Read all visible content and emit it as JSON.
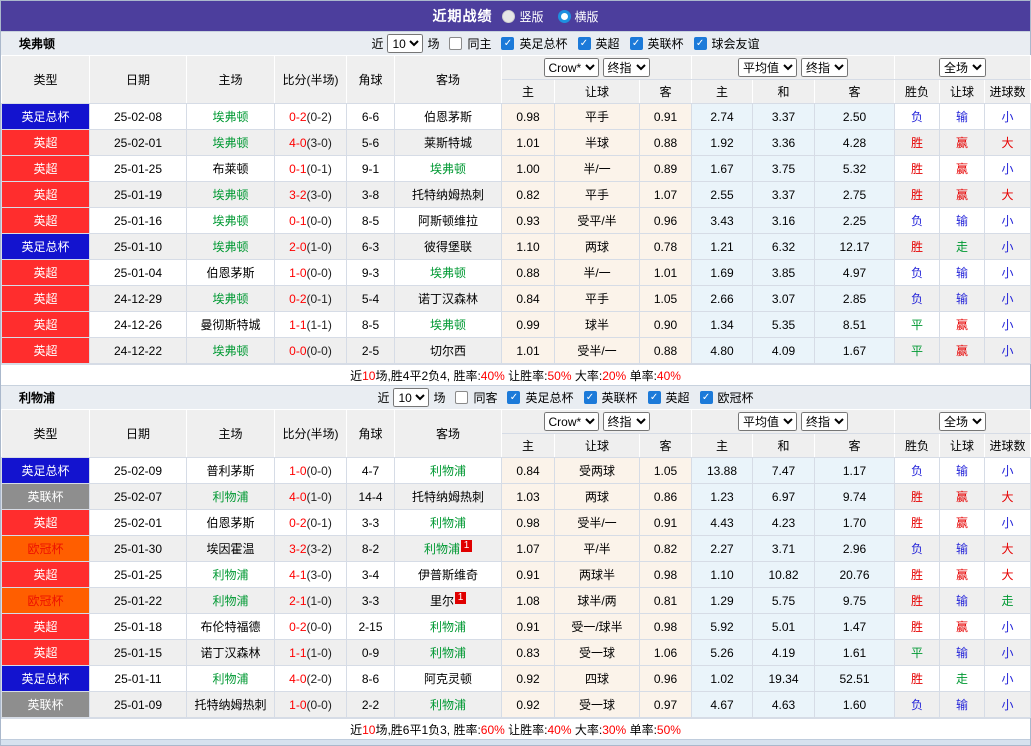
{
  "title_bar": {
    "title": "近期战绩",
    "layout_options": [
      {
        "label": "竖版",
        "selected": true
      },
      {
        "label": "横版",
        "selected": false
      }
    ]
  },
  "columns": {
    "main": [
      "类型",
      "日期",
      "主场",
      "比分(半场)",
      "角球",
      "客场"
    ],
    "odds_groups": [
      {
        "selects": [
          "Crow*",
          "终指"
        ],
        "cols": [
          "主",
          "让球",
          "客"
        ]
      },
      {
        "selects": [
          "平均值",
          "终指"
        ],
        "cols": [
          "主",
          "和",
          "客"
        ]
      },
      {
        "selects": [
          "全场"
        ],
        "cols": [
          "胜负",
          "让球",
          "进球数"
        ]
      }
    ]
  },
  "league_colors": {
    "英足总杯": {
      "bg": "#1313cf",
      "text": "#ffffff"
    },
    "英超": {
      "bg": "#ff2d2d",
      "text": "#ffffff"
    },
    "英联杯": {
      "bg": "#8e8e8e",
      "text": "#ffffff"
    },
    "欧冠杯": {
      "bg": "#ff5e00",
      "text": "#ee1100"
    }
  },
  "result_colors": {
    "胜": "#e60000",
    "赢": "#e60000",
    "大": "#e60000",
    "负": "#2626d9",
    "输": "#2626d9",
    "小": "#2626d9",
    "平": "#009933",
    "走": "#009933"
  },
  "sections": [
    {
      "team": "埃弗顿",
      "filter": {
        "prefix": "近",
        "count": "10",
        "suffix": "场",
        "same_label": "同主",
        "same_checked": false,
        "leagues": [
          {
            "label": "英足总杯",
            "checked": true
          },
          {
            "label": "英超",
            "checked": true
          },
          {
            "label": "英联杯",
            "checked": true
          },
          {
            "label": "球会友谊",
            "checked": true
          }
        ]
      },
      "rows": [
        {
          "league": "英足总杯",
          "date": "25-02-08",
          "home": "埃弗顿",
          "home_self": true,
          "ft": "0-2",
          "ht": "(0-2)",
          "corner": "6-6",
          "away": "伯恩茅斯",
          "away_self": false,
          "away_flag": "",
          "crow": [
            "0.98",
            "平手",
            "0.91"
          ],
          "avg": [
            "2.74",
            "3.37",
            "2.50"
          ],
          "results": [
            "负",
            "输",
            "小"
          ]
        },
        {
          "league": "英超",
          "date": "25-02-01",
          "home": "埃弗顿",
          "home_self": true,
          "ft": "4-0",
          "ht": "(3-0)",
          "corner": "5-6",
          "away": "莱斯特城",
          "away_self": false,
          "away_flag": "",
          "crow": [
            "1.01",
            "半球",
            "0.88"
          ],
          "avg": [
            "1.92",
            "3.36",
            "4.28"
          ],
          "results": [
            "胜",
            "赢",
            "大"
          ]
        },
        {
          "league": "英超",
          "date": "25-01-25",
          "home": "布莱顿",
          "home_self": false,
          "ft": "0-1",
          "ht": "(0-1)",
          "corner": "9-1",
          "away": "埃弗顿",
          "away_self": true,
          "away_flag": "",
          "crow": [
            "1.00",
            "半/一",
            "0.89"
          ],
          "avg": [
            "1.67",
            "3.75",
            "5.32"
          ],
          "results": [
            "胜",
            "赢",
            "小"
          ]
        },
        {
          "league": "英超",
          "date": "25-01-19",
          "home": "埃弗顿",
          "home_self": true,
          "ft": "3-2",
          "ht": "(3-0)",
          "corner": "3-8",
          "away": "托特纳姆热刺",
          "away_self": false,
          "away_flag": "",
          "crow": [
            "0.82",
            "平手",
            "1.07"
          ],
          "avg": [
            "2.55",
            "3.37",
            "2.75"
          ],
          "results": [
            "胜",
            "赢",
            "大"
          ]
        },
        {
          "league": "英超",
          "date": "25-01-16",
          "home": "埃弗顿",
          "home_self": true,
          "ft": "0-1",
          "ht": "(0-0)",
          "corner": "8-5",
          "away": "阿斯顿维拉",
          "away_self": false,
          "away_flag": "",
          "crow": [
            "0.93",
            "受平/半",
            "0.96"
          ],
          "avg": [
            "3.43",
            "3.16",
            "2.25"
          ],
          "results": [
            "负",
            "输",
            "小"
          ]
        },
        {
          "league": "英足总杯",
          "date": "25-01-10",
          "home": "埃弗顿",
          "home_self": true,
          "ft": "2-0",
          "ht": "(1-0)",
          "corner": "6-3",
          "away": "彼得堡联",
          "away_self": false,
          "away_flag": "",
          "crow": [
            "1.10",
            "两球",
            "0.78"
          ],
          "avg": [
            "1.21",
            "6.32",
            "12.17"
          ],
          "results": [
            "胜",
            "走",
            "小"
          ]
        },
        {
          "league": "英超",
          "date": "25-01-04",
          "home": "伯恩茅斯",
          "home_self": false,
          "ft": "1-0",
          "ht": "(0-0)",
          "corner": "9-3",
          "away": "埃弗顿",
          "away_self": true,
          "away_flag": "",
          "crow": [
            "0.88",
            "半/一",
            "1.01"
          ],
          "avg": [
            "1.69",
            "3.85",
            "4.97"
          ],
          "results": [
            "负",
            "输",
            "小"
          ]
        },
        {
          "league": "英超",
          "date": "24-12-29",
          "home": "埃弗顿",
          "home_self": true,
          "ft": "0-2",
          "ht": "(0-1)",
          "corner": "5-4",
          "away": "诺丁汉森林",
          "away_self": false,
          "away_flag": "",
          "crow": [
            "0.84",
            "平手",
            "1.05"
          ],
          "avg": [
            "2.66",
            "3.07",
            "2.85"
          ],
          "results": [
            "负",
            "输",
            "小"
          ]
        },
        {
          "league": "英超",
          "date": "24-12-26",
          "home": "曼彻斯特城",
          "home_self": false,
          "ft": "1-1",
          "ht": "(1-1)",
          "corner": "8-5",
          "away": "埃弗顿",
          "away_self": true,
          "away_flag": "",
          "crow": [
            "0.99",
            "球半",
            "0.90"
          ],
          "avg": [
            "1.34",
            "5.35",
            "8.51"
          ],
          "results": [
            "平",
            "赢",
            "小"
          ]
        },
        {
          "league": "英超",
          "date": "24-12-22",
          "home": "埃弗顿",
          "home_self": true,
          "ft": "0-0",
          "ht": "(0-0)",
          "corner": "2-5",
          "away": "切尔西",
          "away_self": false,
          "away_flag": "",
          "crow": [
            "1.01",
            "受半/一",
            "0.88"
          ],
          "avg": [
            "4.80",
            "4.09",
            "1.67"
          ],
          "results": [
            "平",
            "赢",
            "小"
          ]
        }
      ],
      "summary": {
        "segments": [
          {
            "t": "近",
            "c": "k"
          },
          {
            "t": "10",
            "c": "r"
          },
          {
            "t": "场,胜4平2负4, 胜率:",
            "c": "k"
          },
          {
            "t": "40%",
            "c": "r"
          },
          {
            "t": " 让胜率:",
            "c": "k"
          },
          {
            "t": "50%",
            "c": "r"
          },
          {
            "t": " 大率:",
            "c": "k"
          },
          {
            "t": "20%",
            "c": "r"
          },
          {
            "t": " 单率:",
            "c": "k"
          },
          {
            "t": "40%",
            "c": "r"
          }
        ]
      }
    },
    {
      "team": "利物浦",
      "filter": {
        "prefix": "近",
        "count": "10",
        "suffix": "场",
        "same_label": "同客",
        "same_checked": false,
        "leagues": [
          {
            "label": "英足总杯",
            "checked": true
          },
          {
            "label": "英联杯",
            "checked": true
          },
          {
            "label": "英超",
            "checked": true
          },
          {
            "label": "欧冠杯",
            "checked": true
          }
        ]
      },
      "rows": [
        {
          "league": "英足总杯",
          "date": "25-02-09",
          "home": "普利茅斯",
          "home_self": false,
          "ft": "1-0",
          "ht": "(0-0)",
          "corner": "4-7",
          "away": "利物浦",
          "away_self": true,
          "away_flag": "",
          "crow": [
            "0.84",
            "受两球",
            "1.05"
          ],
          "avg": [
            "13.88",
            "7.47",
            "1.17"
          ],
          "results": [
            "负",
            "输",
            "小"
          ]
        },
        {
          "league": "英联杯",
          "date": "25-02-07",
          "home": "利物浦",
          "home_self": true,
          "ft": "4-0",
          "ht": "(1-0)",
          "corner": "14-4",
          "away": "托特纳姆热刺",
          "away_self": false,
          "away_flag": "",
          "crow": [
            "1.03",
            "两球",
            "0.86"
          ],
          "avg": [
            "1.23",
            "6.97",
            "9.74"
          ],
          "results": [
            "胜",
            "赢",
            "大"
          ]
        },
        {
          "league": "英超",
          "date": "25-02-01",
          "home": "伯恩茅斯",
          "home_self": false,
          "ft": "0-2",
          "ht": "(0-1)",
          "corner": "3-3",
          "away": "利物浦",
          "away_self": true,
          "away_flag": "",
          "crow": [
            "0.98",
            "受半/一",
            "0.91"
          ],
          "avg": [
            "4.43",
            "4.23",
            "1.70"
          ],
          "results": [
            "胜",
            "赢",
            "小"
          ]
        },
        {
          "league": "欧冠杯",
          "date": "25-01-30",
          "home": "埃因霍温",
          "home_self": false,
          "ft": "3-2",
          "ht": "(3-2)",
          "corner": "8-2",
          "away": "利物浦",
          "away_self": true,
          "away_flag": "1",
          "crow": [
            "1.07",
            "平/半",
            "0.82"
          ],
          "avg": [
            "2.27",
            "3.71",
            "2.96"
          ],
          "results": [
            "负",
            "输",
            "大"
          ]
        },
        {
          "league": "英超",
          "date": "25-01-25",
          "home": "利物浦",
          "home_self": true,
          "ft": "4-1",
          "ht": "(3-0)",
          "corner": "3-4",
          "away": "伊普斯维奇",
          "away_self": false,
          "away_flag": "",
          "crow": [
            "0.91",
            "两球半",
            "0.98"
          ],
          "avg": [
            "1.10",
            "10.82",
            "20.76"
          ],
          "results": [
            "胜",
            "赢",
            "大"
          ]
        },
        {
          "league": "欧冠杯",
          "date": "25-01-22",
          "home": "利物浦",
          "home_self": true,
          "ft": "2-1",
          "ht": "(1-0)",
          "corner": "3-3",
          "away": "里尔",
          "away_self": false,
          "away_flag": "1",
          "crow": [
            "1.08",
            "球半/两",
            "0.81"
          ],
          "avg": [
            "1.29",
            "5.75",
            "9.75"
          ],
          "results": [
            "胜",
            "输",
            "走"
          ]
        },
        {
          "league": "英超",
          "date": "25-01-18",
          "home": "布伦特福德",
          "home_self": false,
          "ft": "0-2",
          "ht": "(0-0)",
          "corner": "2-15",
          "away": "利物浦",
          "away_self": true,
          "away_flag": "",
          "crow": [
            "0.91",
            "受一/球半",
            "0.98"
          ],
          "avg": [
            "5.92",
            "5.01",
            "1.47"
          ],
          "results": [
            "胜",
            "赢",
            "小"
          ]
        },
        {
          "league": "英超",
          "date": "25-01-15",
          "home": "诺丁汉森林",
          "home_self": false,
          "ft": "1-1",
          "ht": "(1-0)",
          "corner": "0-9",
          "away": "利物浦",
          "away_self": true,
          "away_flag": "",
          "crow": [
            "0.83",
            "受一球",
            "1.06"
          ],
          "avg": [
            "5.26",
            "4.19",
            "1.61"
          ],
          "results": [
            "平",
            "输",
            "小"
          ]
        },
        {
          "league": "英足总杯",
          "date": "25-01-11",
          "home": "利物浦",
          "home_self": true,
          "ft": "4-0",
          "ht": "(2-0)",
          "corner": "8-6",
          "away": "阿克灵顿",
          "away_self": false,
          "away_flag": "",
          "crow": [
            "0.92",
            "四球",
            "0.96"
          ],
          "avg": [
            "1.02",
            "19.34",
            "52.51"
          ],
          "results": [
            "胜",
            "走",
            "小"
          ]
        },
        {
          "league": "英联杯",
          "date": "25-01-09",
          "home": "托特纳姆热刺",
          "home_self": false,
          "ft": "1-0",
          "ht": "(0-0)",
          "corner": "2-2",
          "away": "利物浦",
          "away_self": true,
          "away_flag": "",
          "crow": [
            "0.92",
            "受一球",
            "0.97"
          ],
          "avg": [
            "4.67",
            "4.63",
            "1.60"
          ],
          "results": [
            "负",
            "输",
            "小"
          ]
        }
      ],
      "summary": {
        "segments": [
          {
            "t": "近",
            "c": "k"
          },
          {
            "t": "10",
            "c": "r"
          },
          {
            "t": "场,胜6平1负3, 胜率:",
            "c": "k"
          },
          {
            "t": "60%",
            "c": "r"
          },
          {
            "t": " 让胜率:",
            "c": "k"
          },
          {
            "t": "40%",
            "c": "r"
          },
          {
            "t": " 大率:",
            "c": "k"
          },
          {
            "t": "30%",
            "c": "r"
          },
          {
            "t": " 单率:",
            "c": "k"
          },
          {
            "t": "50%",
            "c": "r"
          }
        ]
      }
    }
  ]
}
